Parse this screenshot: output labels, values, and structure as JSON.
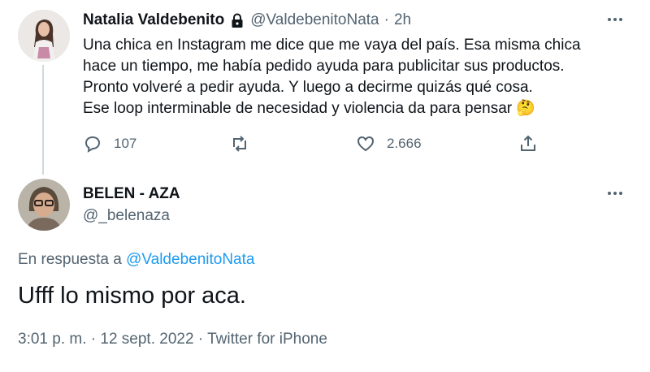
{
  "parent_tweet": {
    "name": "Natalia Valdebenito",
    "handle": "@ValdebenitoNata",
    "separator": "·",
    "time": "2h",
    "text_lines": [
      "Una chica en Instagram me dice que me vaya del país. Esa misma chica",
      "hace un tiempo, me había pedido ayuda para publicitar sus productos.",
      "Pronto volveré a pedir ayuda. Y luego a decirme quizás qué cosa.",
      "Ese loop interminable de necesidad y violencia da para pensar"
    ],
    "emoji": "🤔",
    "reply_count": "107",
    "like_count": "2.666"
  },
  "main_tweet": {
    "name": "BELEN - AZA",
    "handle": "@_belenaza",
    "reply_prefix": "En respuesta a",
    "reply_to": "@ValdebenitoNata",
    "text": "Ufff lo mismo por aca.",
    "timestamp": "3:01 p. m. · 12 sept. 2022 · Twitter for iPhone"
  },
  "icons": [
    "lock-icon",
    "more-icon",
    "reply-icon",
    "retweet-icon",
    "like-icon",
    "share-icon"
  ],
  "colors": {
    "link": "#1d9bf0",
    "muted": "#536471",
    "text": "#0f1419",
    "thread_line": "#cfd9de"
  }
}
